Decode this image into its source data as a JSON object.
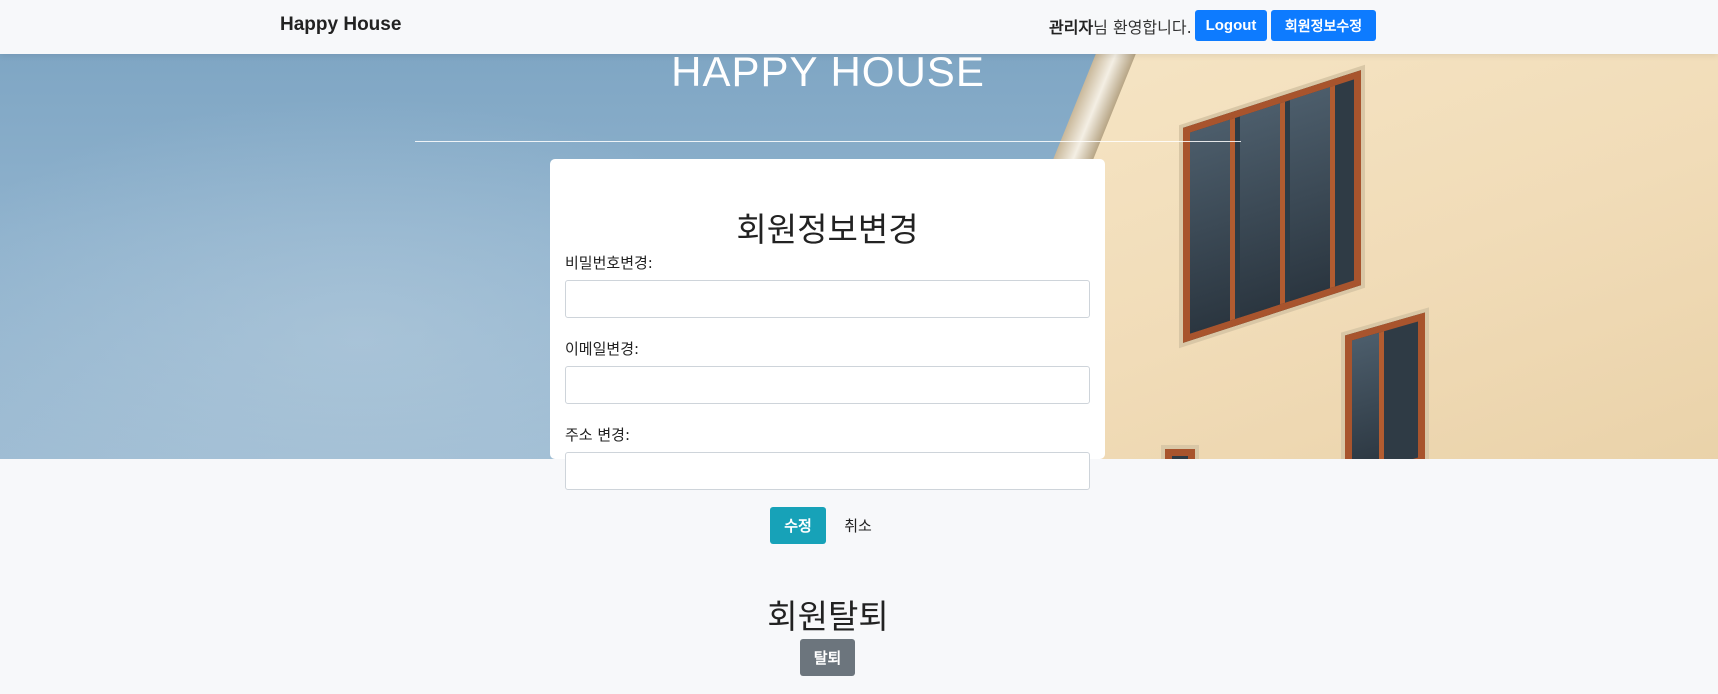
{
  "navbar": {
    "brand": "Happy House",
    "user_name": "관리자",
    "welcome_suffix": "님 환영합니다.",
    "logout_label": "Logout",
    "edit_profile_label": "회원정보수정"
  },
  "hero": {
    "title": "HAPPY HOUSE"
  },
  "form": {
    "title": "회원정보변경",
    "password_label": "비밀번호변경:",
    "password_value": "",
    "email_label": "이메일변경:",
    "email_value": "",
    "address_label": "주소 변경:",
    "address_value": "",
    "submit_label": "수정",
    "cancel_label": "취소"
  },
  "withdraw": {
    "title": "회원탈퇴",
    "button_label": "탈퇴"
  },
  "colors": {
    "primary": "#0d7bff",
    "info": "#17a2b8",
    "secondary": "#6c757d",
    "background": "#f7f8fa"
  }
}
